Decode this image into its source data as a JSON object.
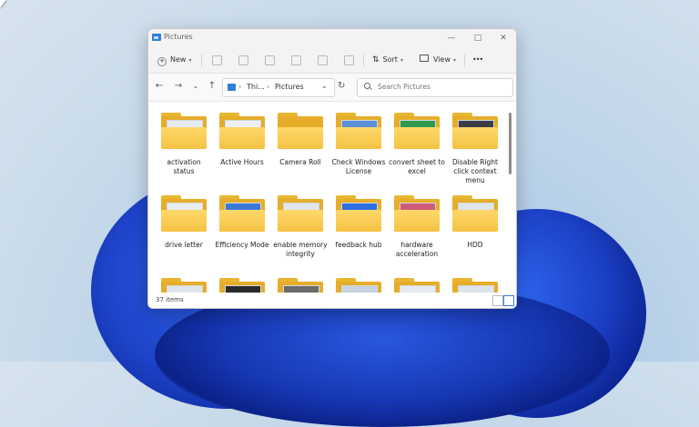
{
  "window": {
    "title": "Pictures",
    "minimize": "—",
    "maximize": "□",
    "close": "✕"
  },
  "toolbar": {
    "new_label": "New",
    "sort_label": "Sort",
    "view_label": "View",
    "more_label": "•••"
  },
  "nav": {
    "breadcrumb": [
      "Thi...",
      "Pictures"
    ],
    "search_placeholder": "Search Pictures"
  },
  "items": [
    {
      "name": "activation status",
      "paper": "#e6eaf0"
    },
    {
      "name": "Active Hours",
      "paper": "#edf0f4"
    },
    {
      "name": "Camera Roll",
      "paper": ""
    },
    {
      "name": "Check Windows License",
      "paper": "#5a8fd6"
    },
    {
      "name": "convert sheet to excel",
      "paper": "#2f9a4d"
    },
    {
      "name": "Disable Right click context menu",
      "paper": "#3b3f45"
    },
    {
      "name": "drive letter",
      "paper": "#e8ecf1"
    },
    {
      "name": "Efficiency Mode",
      "paper": "#3c78d8"
    },
    {
      "name": "enable memory integrity",
      "paper": "#e1e6ee"
    },
    {
      "name": "feedback hub",
      "paper": "#2e6fe0"
    },
    {
      "name": "hardware acceleration",
      "paper": "#d05a7a"
    },
    {
      "name": "HDD",
      "paper": "#dfe5ec"
    },
    {
      "name": "",
      "paper": "#dfe5ec"
    },
    {
      "name": "",
      "paper": "#2a2a2a"
    },
    {
      "name": "",
      "paper": "#6a6a6a"
    },
    {
      "name": "",
      "paper": "#c9d3df"
    },
    {
      "name": "",
      "paper": "#e6e9ee"
    },
    {
      "name": "",
      "paper": "#dfe4eb"
    }
  ],
  "status": {
    "count": "37 items"
  }
}
